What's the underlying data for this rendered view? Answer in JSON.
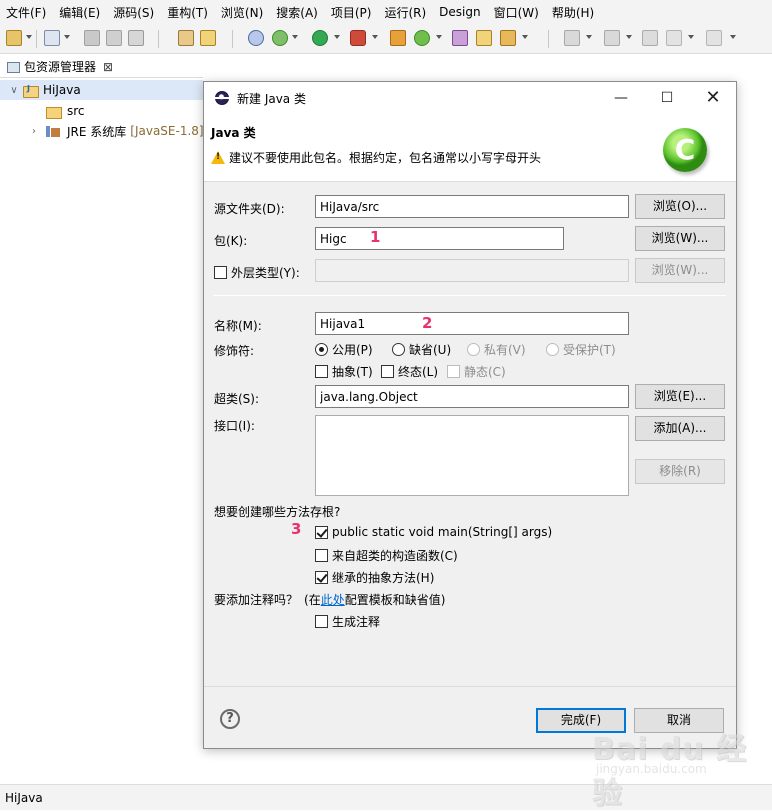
{
  "menubar": {
    "items": [
      "文件(F)",
      "编辑(E)",
      "源码(S)",
      "重构(T)",
      "浏览(N)",
      "搜索(A)",
      "项目(P)",
      "运行(R)",
      "Design",
      "窗口(W)",
      "帮助(H)"
    ]
  },
  "view": {
    "tab_label": "包资源管理器",
    "close_glyph": "⊠"
  },
  "tree": {
    "project": "HiJava",
    "src": "src",
    "jre_label": "JRE 系统库",
    "jre_suffix": "[JavaSE-1.8]"
  },
  "status": {
    "text": "HiJava"
  },
  "dialog": {
    "title": "新建 Java 类",
    "header_title": "Java 类",
    "warning": "建议不要使用此包名。根据约定，包名通常以小写字母开头",
    "source_folder": {
      "label": "源文件夹(D):",
      "value": "HiJava/src",
      "browse": "浏览(O)..."
    },
    "package": {
      "label": "包(K):",
      "value": "Higc",
      "browse": "浏览(W)..."
    },
    "enclosing": {
      "label": "外层类型(Y):",
      "value": "",
      "browse": "浏览(W)..."
    },
    "name": {
      "label": "名称(M):",
      "value": "Hijava1"
    },
    "modifiers": {
      "label": "修饰符:",
      "public": "公用(P)",
      "default": "缺省(U)",
      "private": "私有(V)",
      "protected": "受保护(T)",
      "abstract": "抽象(T)",
      "final": "终态(L)",
      "static": "静态(C)"
    },
    "superclass": {
      "label": "超类(S):",
      "value": "java.lang.Object",
      "browse": "浏览(E)..."
    },
    "interfaces": {
      "label": "接口(I):",
      "add": "添加(A)...",
      "remove": "移除(R)"
    },
    "stubs": {
      "question": "想要创建哪些方法存根?",
      "main": "public static void main(String[] args)",
      "constructors": "来自超类的构造函数(C)",
      "inherited": "继承的抽象方法(H)"
    },
    "comments": {
      "question": "要添加注释吗？",
      "open": "(在",
      "link": "此处",
      "rest": "配置模板和缺省值)",
      "generate": "生成注释"
    },
    "finish": "完成(F)",
    "cancel": "取消"
  },
  "annotations": {
    "one": "1",
    "two": "2",
    "three": "3"
  },
  "watermark": {
    "big": "Bai du 经验",
    "small": "jingyan.baidu.com"
  },
  "colors": {
    "annotation": "#e8336a",
    "link": "#0066cc",
    "accent": "#0078d7"
  }
}
